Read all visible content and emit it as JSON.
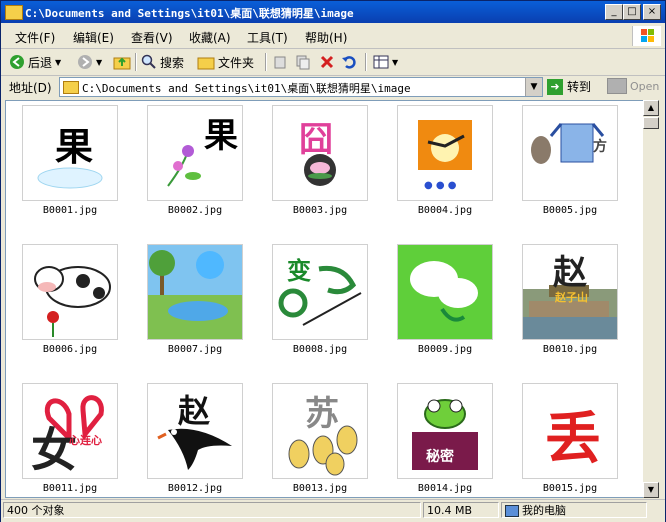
{
  "window": {
    "title": "C:\\Documents and Settings\\it01\\桌面\\联想猜明星\\image"
  },
  "menu": [
    "文件(F)",
    "编辑(E)",
    "查看(V)",
    "收藏(A)",
    "工具(T)",
    "帮助(H)"
  ],
  "toolbar": {
    "back": "后退",
    "search": "搜索",
    "folders": "文件夹"
  },
  "address": {
    "label": "地址(D)",
    "value": "C:\\Documents and Settings\\it01\\桌面\\联想猜明星\\image",
    "go": "转到",
    "open": "Open"
  },
  "files": [
    {
      "name": "B0001.jpg",
      "glyph": "果"
    },
    {
      "name": "B0002.jpg",
      "glyph": "果"
    },
    {
      "name": "B0003.jpg",
      "glyph": "囧"
    },
    {
      "name": "B0004.jpg",
      "glyph": ""
    },
    {
      "name": "B0005.jpg",
      "glyph": "方"
    },
    {
      "name": "B0006.jpg",
      "glyph": ""
    },
    {
      "name": "B0007.jpg",
      "glyph": ""
    },
    {
      "name": "B0008.jpg",
      "glyph": "变"
    },
    {
      "name": "B0009.jpg",
      "glyph": ""
    },
    {
      "name": "B0010.jpg",
      "glyph": "赵",
      "caption": "赵子山"
    },
    {
      "name": "B0011.jpg",
      "glyph": "女",
      "caption": "心连心"
    },
    {
      "name": "B0012.jpg",
      "glyph": "赵"
    },
    {
      "name": "B0013.jpg",
      "glyph": "苏"
    },
    {
      "name": "B0014.jpg",
      "glyph": "",
      "caption": "秘密"
    },
    {
      "name": "B0015.jpg",
      "glyph": "丢"
    }
  ],
  "status": {
    "count": "400 个对象",
    "size": "10.4 MB",
    "location": "我的电脑"
  },
  "colors": {
    "title_bar": "#0a4fc8",
    "chrome": "#ece9d8",
    "panel_border": "#7f9db9"
  }
}
